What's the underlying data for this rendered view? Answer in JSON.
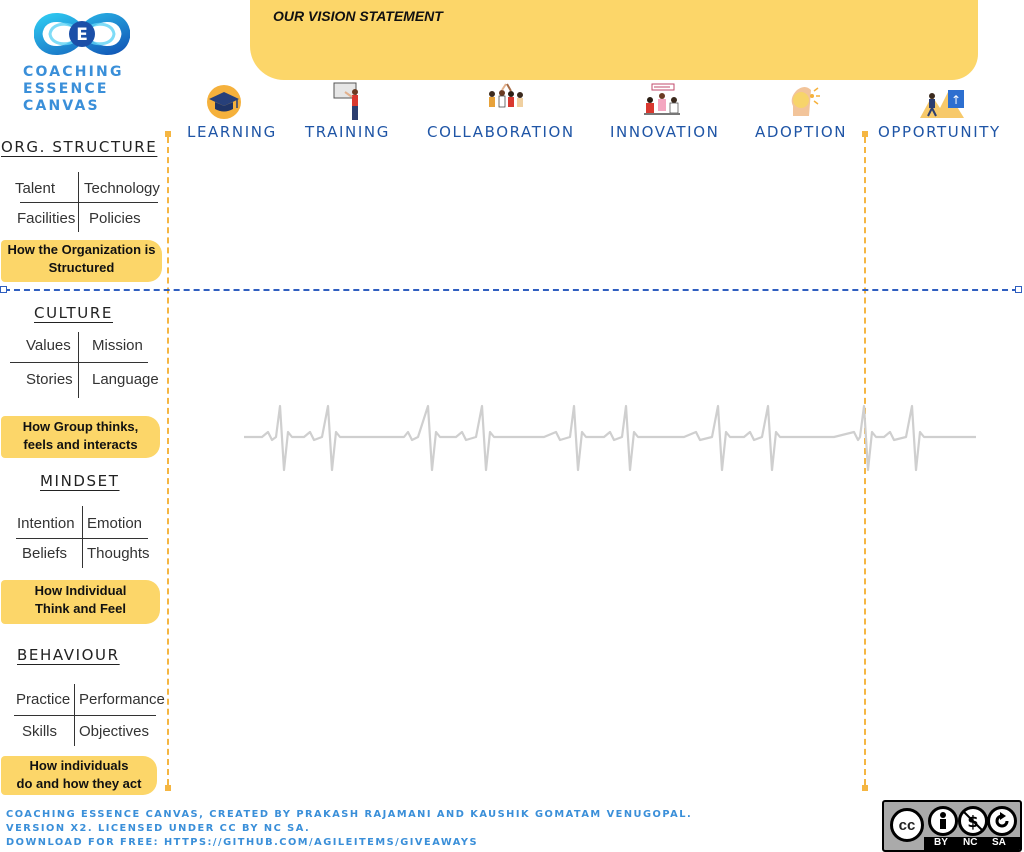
{
  "logo": {
    "icon": "double-loop-logo-icon",
    "line1": "COACHING",
    "line2": "ESSENCE",
    "line3": "CANVAS"
  },
  "vision": {
    "title": "OUR VISION STATEMENT"
  },
  "phases": [
    {
      "label": "LEARNING",
      "icon": "graduation-cap-icon"
    },
    {
      "label": "TRAINING",
      "icon": "presenter-icon"
    },
    {
      "label": "COLLABORATION",
      "icon": "team-high-five-icon"
    },
    {
      "label": "INNOVATION",
      "icon": "brainstorm-team-icon"
    },
    {
      "label": "ADOPTION",
      "icon": "lightbulb-head-icon"
    },
    {
      "label": "OPPORTUNITY",
      "icon": "climbing-goal-icon"
    }
  ],
  "sections": {
    "org": {
      "title": "ORG. STRUCTURE",
      "cells": [
        "Talent",
        "Technology",
        "Facilities",
        "Policies"
      ],
      "note_line1": "How the Organization is",
      "note_line2": "Structured"
    },
    "culture": {
      "title": "CULTURE",
      "cells": [
        "Values",
        "Mission",
        "Stories",
        "Language"
      ],
      "note_line1": "How Group thinks,",
      "note_line2": "feels and interacts"
    },
    "mindset": {
      "title": "MINDSET",
      "cells": [
        "Intention",
        "Emotion",
        "Beliefs",
        "Thoughts"
      ],
      "note_line1": "How Individual",
      "note_line2": "Think and Feel"
    },
    "behaviour": {
      "title": "BEHAVIOUR",
      "cells": [
        "Practice",
        "Performance",
        "Skills",
        "Objectives"
      ],
      "note_line1": "How individuals",
      "note_line2": "do and how they act"
    }
  },
  "colors": {
    "accent_yellow": "#fcd669",
    "phase_blue": "#1f55a6",
    "dashed_orange": "#f5b642",
    "divider_blue": "#2f5fc0",
    "footer_blue": "#3a8fd9",
    "heartbeat_gray": "#cfcfcf"
  },
  "footer": {
    "line1": "COACHING ESSENCE CANVAS, CREATED BY PRAKASH RAJAMANI AND KAUSHIK GOMATAM VENUGOPAL.",
    "line2": "VERSION X2. LICENSED UNDER CC BY NC SA.",
    "line3": "DOWNLOAD FOR FREE: HTTPS://GITHUB.COM/AGILEITEMS/GIVEAWAYS"
  },
  "license_badge": {
    "by": "BY",
    "nc": "NC",
    "sa": "SA",
    "cc_mark": "cc"
  }
}
